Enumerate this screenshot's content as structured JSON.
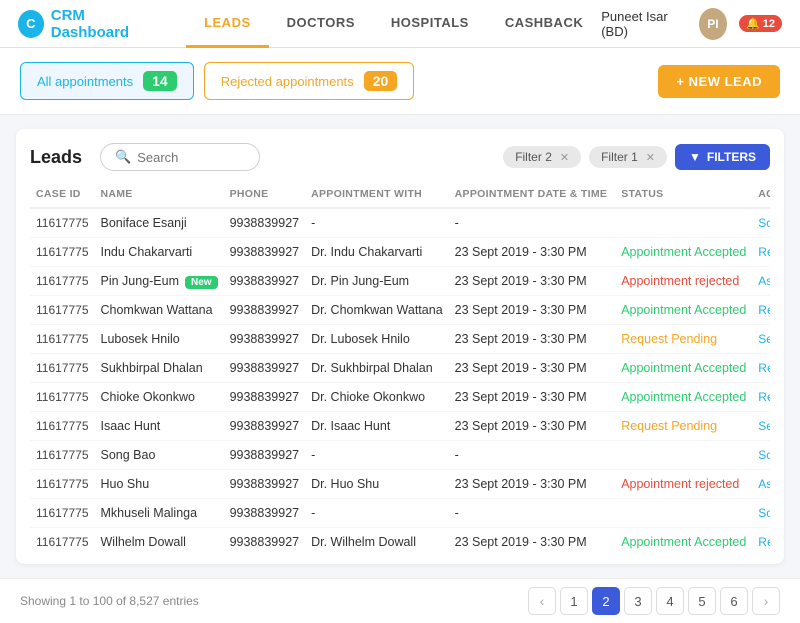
{
  "header": {
    "logo_text": "CRM Dashboard",
    "nav_items": [
      "LEADS",
      "DOCTORS",
      "HOSPITALS",
      "CASHBACK"
    ],
    "active_nav": "LEADS",
    "user_name": "Puneet Isar (BD)",
    "notif_count": "12"
  },
  "subheader": {
    "tab1_label": "All appointments",
    "tab1_count": "14",
    "tab2_label": "Rejected appointments",
    "tab2_count": "20",
    "new_lead_btn": "+ NEW LEAD"
  },
  "leads": {
    "title": "Leads",
    "search_placeholder": "Search",
    "filter1": "Filter 2",
    "filter2": "Filter 1",
    "filters_btn": "FILTERS",
    "columns": [
      "CASE ID",
      "NAME",
      "PHONE",
      "APPOINTMENT WITH",
      "APPOINTMENT DATE & TIME",
      "STATUS",
      "ACTION TO BE TAKEN"
    ],
    "rows": [
      {
        "case_id": "11617775",
        "name": "Boniface Esanji",
        "phone": "9938839927",
        "appointment_with": "-",
        "date_time": "-",
        "status": "",
        "action": "Schedule appointment",
        "is_new": false
      },
      {
        "case_id": "11617775",
        "name": "Indu Chakarvarti",
        "phone": "9938839927",
        "appointment_with": "Dr. Indu Chakarvarti",
        "date_time": "23 Sept 2019 - 3:30 PM",
        "status": "Appointment Accepted",
        "action": "Reschedule appointment",
        "is_new": false
      },
      {
        "case_id": "11617775",
        "name": "Pin Jung-Eum",
        "phone": "9938839927",
        "appointment_with": "Dr. Pin Jung-Eum",
        "date_time": "23 Sept 2019 - 3:30 PM",
        "status": "Appointment rejected",
        "action": "Assign to other doctor",
        "is_new": true
      },
      {
        "case_id": "11617775",
        "name": "Chomkwan Wattana",
        "phone": "9938839927",
        "appointment_with": "Dr. Chomkwan Wattana",
        "date_time": "23 Sept 2019 - 3:30 PM",
        "status": "Appointment Accepted",
        "action": "Reschedule appointment",
        "is_new": false
      },
      {
        "case_id": "11617775",
        "name": "Lubosek Hnilo",
        "phone": "9938839927",
        "appointment_with": "Dr. Lubosek Hnilo",
        "date_time": "23 Sept 2019 - 3:30 PM",
        "status": "Request Pending",
        "action": "Send reminder",
        "is_new": false
      },
      {
        "case_id": "11617775",
        "name": "Sukhbirpal Dhalan",
        "phone": "9938839927",
        "appointment_with": "Dr. Sukhbirpal Dhalan",
        "date_time": "23 Sept 2019 - 3:30 PM",
        "status": "Appointment Accepted",
        "action": "Reschedule appointment",
        "is_new": false
      },
      {
        "case_id": "11617775",
        "name": "Chioke Okonkwo",
        "phone": "9938839927",
        "appointment_with": "Dr. Chioke Okonkwo",
        "date_time": "23 Sept 2019 - 3:30 PM",
        "status": "Appointment Accepted",
        "action": "Reschedule appointment",
        "is_new": false
      },
      {
        "case_id": "11617775",
        "name": "Isaac Hunt",
        "phone": "9938839927",
        "appointment_with": "Dr. Isaac Hunt",
        "date_time": "23 Sept 2019 - 3:30 PM",
        "status": "Request Pending",
        "action": "Send reminder",
        "is_new": false
      },
      {
        "case_id": "11617775",
        "name": "Song Bao",
        "phone": "9938839927",
        "appointment_with": "-",
        "date_time": "-",
        "status": "",
        "action": "Schedule",
        "is_new": false
      },
      {
        "case_id": "11617775",
        "name": "Huo Shu",
        "phone": "9938839927",
        "appointment_with": "Dr. Huo Shu",
        "date_time": "23 Sept 2019 - 3:30 PM",
        "status": "Appointment rejected",
        "action": "Assign to other doctor",
        "is_new": false
      },
      {
        "case_id": "11617775",
        "name": "Mkhuseli Malinga",
        "phone": "9938839927",
        "appointment_with": "-",
        "date_time": "-",
        "status": "",
        "action": "Schedule",
        "is_new": false
      },
      {
        "case_id": "11617775",
        "name": "Wilhelm Dowall",
        "phone": "9938839927",
        "appointment_with": "Dr. Wilhelm Dowall",
        "date_time": "23 Sept 2019 - 3:30 PM",
        "status": "Appointment Accepted",
        "action": "Reschedule appointment",
        "is_new": false
      }
    ]
  },
  "footer": {
    "showing_text": "Showing 1 to 100 of 8,527 entries",
    "pages": [
      "1",
      "2",
      "3",
      "4",
      "5",
      "6"
    ],
    "active_page": "2"
  }
}
